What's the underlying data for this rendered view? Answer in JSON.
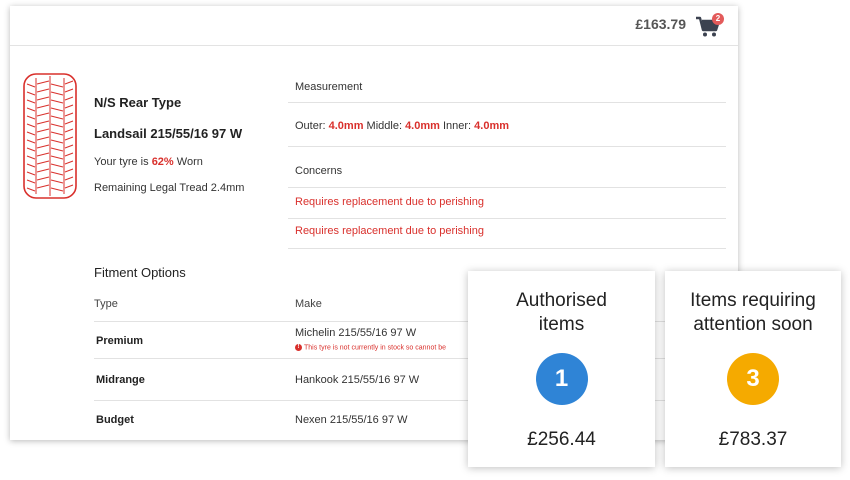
{
  "header": {
    "total": "£163.79",
    "cart_count": "2"
  },
  "tyre": {
    "position_title": "N/S Rear Type",
    "name": "Landsail 215/55/16 97 W",
    "worn_prefix": "Your tyre is ",
    "worn_percent": "62%",
    "worn_suffix": " Worn",
    "legal_tread": "Remaining Legal Tread 2.4mm"
  },
  "measurement": {
    "label": "Measurement",
    "outer_label": "Outer: ",
    "outer_value": "4.0mm",
    "middle_label": " Middle: ",
    "middle_value": "4.0mm",
    "inner_label": " Inner: ",
    "inner_value": "4.0mm"
  },
  "concerns": {
    "label": "Concerns",
    "items": [
      "Requires replacement due to perishing",
      "Requires replacement due to perishing"
    ]
  },
  "fitment": {
    "title": "Fitment Options",
    "col_type": "Type",
    "col_make": "Make",
    "rows": [
      {
        "type": "Premium",
        "make": "Michelin 215/55/16 97 W",
        "warning": "This tyre is not currently in stock so cannot be"
      },
      {
        "type": "Midrange",
        "make": "Hankook 215/55/16 97 W"
      },
      {
        "type": "Budget",
        "make": "Nexen 215/55/16 97 W"
      }
    ]
  },
  "cards": [
    {
      "title_line1": "Authorised",
      "title_line2": "items",
      "count": "1",
      "amount": "£256.44",
      "color": "#2f84d6"
    },
    {
      "title_line1": "Items requiring",
      "title_line2": "attention soon",
      "count": "3",
      "amount": "£783.37",
      "color": "#f5aa00"
    }
  ]
}
